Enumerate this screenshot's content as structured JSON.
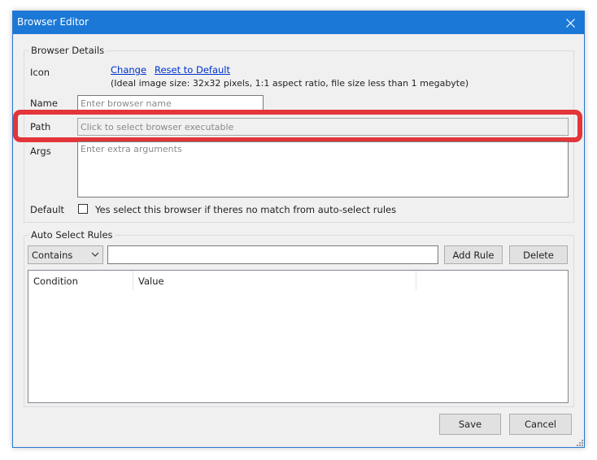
{
  "window": {
    "title": "Browser Editor"
  },
  "browser_details": {
    "legend": "Browser Details",
    "icon_label": "Icon",
    "change_link": "Change",
    "reset_link": "Reset to Default",
    "icon_hint": "(Ideal image size: 32x32 pixels, 1:1 aspect ratio, file size less than 1 megabyte)",
    "name_label": "Name",
    "name_placeholder": "Enter browser name",
    "path_label": "Path",
    "path_placeholder": "Click to select browser executable",
    "args_label": "Args",
    "args_placeholder": "Enter extra arguments",
    "default_label": "Default",
    "default_checkbox_text": "Yes select this browser if theres no match from auto-select rules",
    "default_checked": false
  },
  "auto_select": {
    "legend": "Auto Select Rules",
    "match_type_selected": "Contains",
    "rule_value": "",
    "add_rule_label": "Add Rule",
    "delete_label": "Delete",
    "columns": [
      "Condition",
      "Value"
    ]
  },
  "footer": {
    "save_label": "Save",
    "cancel_label": "Cancel"
  },
  "colors": {
    "titlebar": "#1b78d6",
    "highlight": "#e3353a",
    "link": "#0033cc"
  }
}
